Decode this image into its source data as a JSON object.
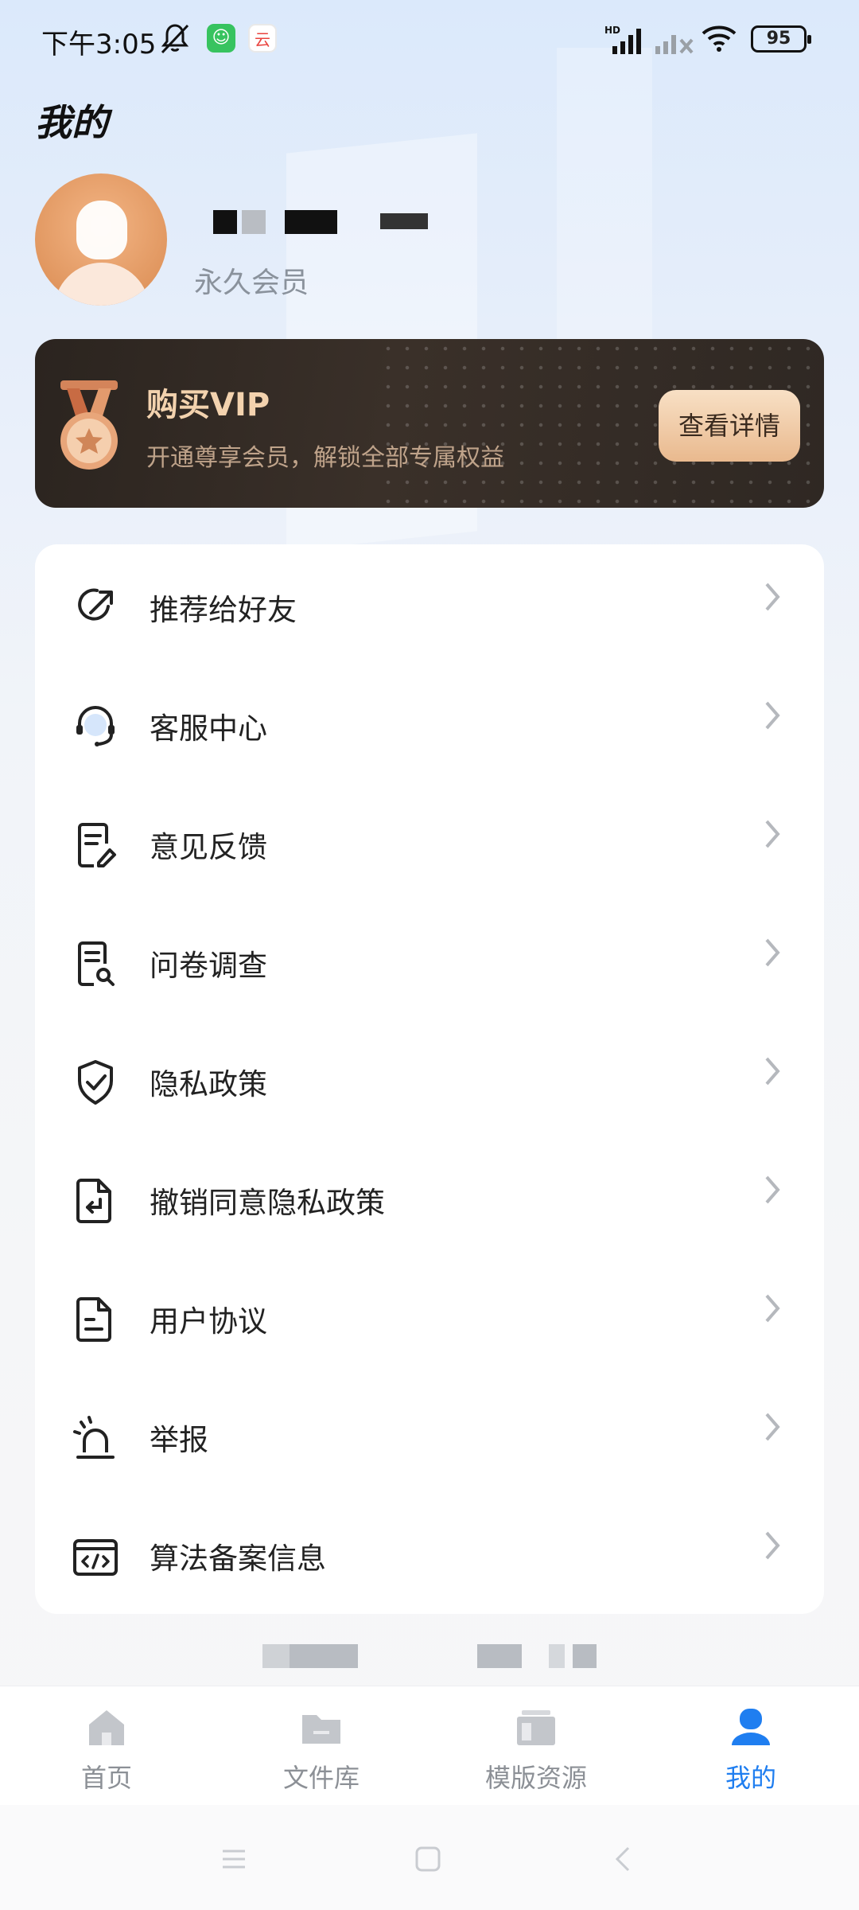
{
  "status_bar": {
    "time": "下午3:05",
    "network": "HD",
    "battery": "95",
    "cloud_app_glyph": "云"
  },
  "header": {
    "title": "我的"
  },
  "profile": {
    "member_level": "永久会员"
  },
  "vip": {
    "title": "购买VIP",
    "subtitle": "开通尊享会员，解锁全部专属权益",
    "button_label": "查看详情"
  },
  "menu": {
    "items": [
      {
        "label": "推荐给好友",
        "icon": "share-icon"
      },
      {
        "label": "客服中心",
        "icon": "headset-icon"
      },
      {
        "label": "意见反馈",
        "icon": "feedback-icon"
      },
      {
        "label": "问卷调查",
        "icon": "survey-icon"
      },
      {
        "label": "隐私政策",
        "icon": "shield-check-icon"
      },
      {
        "label": "撤销同意隐私政策",
        "icon": "revoke-document-icon"
      },
      {
        "label": "用户协议",
        "icon": "agreement-document-icon"
      },
      {
        "label": "举报",
        "icon": "alarm-icon"
      },
      {
        "label": "算法备案信息",
        "icon": "code-icon"
      }
    ]
  },
  "bottom_nav": {
    "items": [
      {
        "label": "首页",
        "icon": "home-icon",
        "active": false
      },
      {
        "label": "文件库",
        "icon": "folder-icon",
        "active": false
      },
      {
        "label": "模版资源",
        "icon": "template-icon",
        "active": false
      },
      {
        "label": "我的",
        "icon": "user-icon",
        "active": true
      }
    ]
  },
  "colors": {
    "accent": "#1f7ef0",
    "vip_gold": "#f3d2ae",
    "vip_bg": "#2b241f"
  }
}
